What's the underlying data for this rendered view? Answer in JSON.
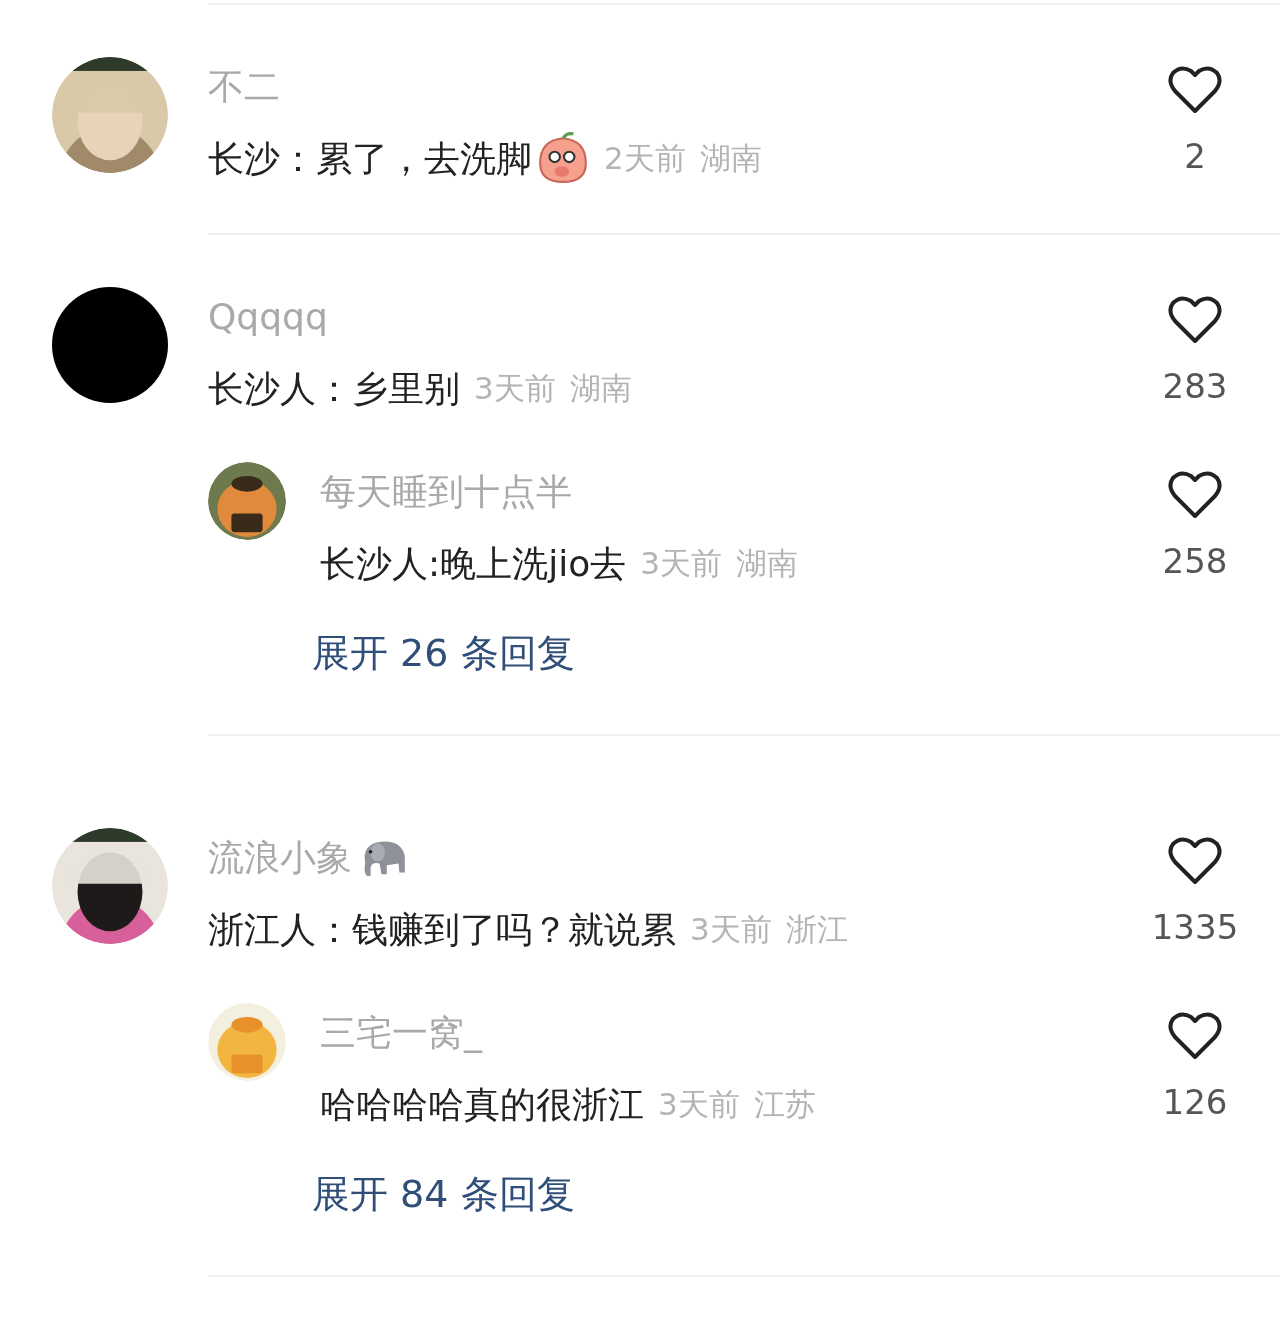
{
  "comments": [
    {
      "name": "不二",
      "text": "长沙：累了，去洗脚",
      "text_emoji": true,
      "time": "2天前",
      "region": "湖南",
      "likes": "2",
      "liked": false
    },
    {
      "avatar": {
        "kind": "plain"
      },
      "name": "Qqqqq",
      "text": "长沙人：乡里别",
      "time": "3天前",
      "region": "湖南",
      "likes": "283",
      "liked": false,
      "replies": [
        {
          "name": "每天睡到十点半",
          "text": "长沙人:晚上洗jio去",
          "time": "3天前",
          "region": "湖南",
          "likes": "258",
          "liked": false
        }
      ],
      "expand": "展开 26 条回复"
    },
    {
      "name": "流浪小象",
      "name_emoji": true,
      "text": "浙江人：钱赚到了吗？就说累",
      "time": "3天前",
      "region": "浙江",
      "likes": "1335",
      "liked": false,
      "replies": [
        {
          "name": "三宅一窝_",
          "text": "哈哈哈哈真的很浙江",
          "time": "3天前",
          "region": "江苏",
          "likes": "126",
          "liked": false
        }
      ],
      "expand": "展开 84 条回复"
    }
  ]
}
